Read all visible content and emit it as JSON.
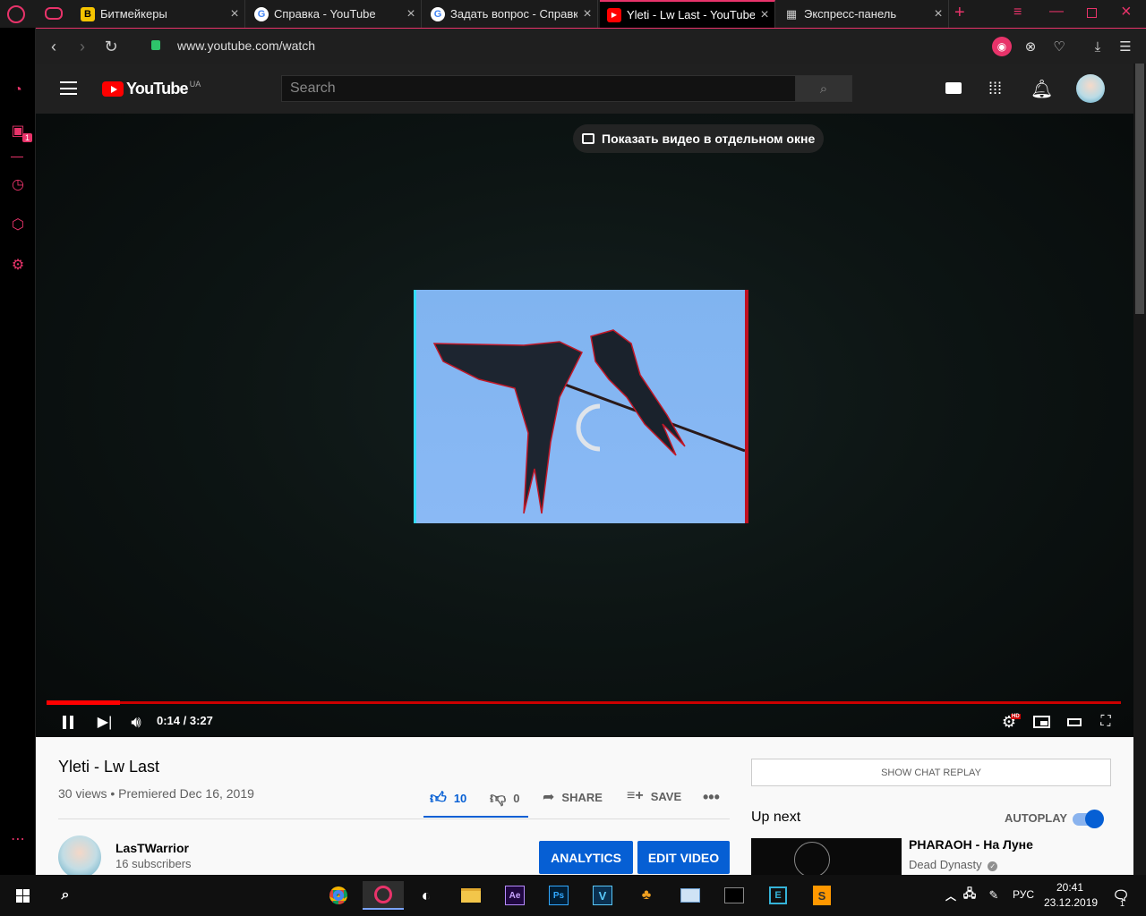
{
  "browser": {
    "tabs": [
      {
        "title": "Битмейкеры",
        "favicon": "B",
        "favicon_color": "#f5c400",
        "active": false
      },
      {
        "title": "Справка - YouTube",
        "favicon": "G",
        "favicon_color": "#4285f4",
        "active": false
      },
      {
        "title": "Задать вопрос - Справка",
        "favicon": "G",
        "favicon_color": "#4285f4",
        "active": false
      },
      {
        "title": "Yleti - Lw Last - YouTube",
        "favicon": "▶",
        "favicon_color": "#ff0000",
        "active": true
      },
      {
        "title": "Экспресс-панель",
        "favicon": "▦",
        "favicon_color": "#cccccc",
        "active": false
      }
    ],
    "url": "www.youtube.com/watch",
    "accent": "#e8336a",
    "sidebar_badge": "1"
  },
  "youtube": {
    "logo_text": "YouTube",
    "region": "UA",
    "search_placeholder": "Search"
  },
  "player": {
    "pip_banner": "Показать видео в отдельном окне",
    "time": "0:14 / 3:27",
    "progress": 0.068
  },
  "video": {
    "title": "Yleti - Lw Last",
    "meta": "30 views • Premiered Dec 16, 2019",
    "likes": "10",
    "dislikes": "0",
    "share_label": "SHARE",
    "save_label": "SAVE",
    "channel_name": "LasTWarrior",
    "subscribers": "16 subscribers",
    "analytics_label": "ANALYTICS",
    "edit_label": "EDIT VIDEO"
  },
  "sidebar_right": {
    "chat_replay": "SHOW CHAT REPLAY",
    "up_next": "Up next",
    "autoplay": "AUTOPLAY",
    "next_title": "PHARAOH - На Луне",
    "next_channel": "Dead Dynasty"
  },
  "taskbar": {
    "lang": "РУС",
    "time": "20:41",
    "date": "23.12.2019",
    "notif_count": "1",
    "apps": [
      "Chrome",
      "Opera",
      "Steam",
      "Explorer",
      "Ae",
      "Ps",
      "V",
      "App",
      "Mail",
      "Terminal",
      "E",
      "Sublime"
    ]
  }
}
